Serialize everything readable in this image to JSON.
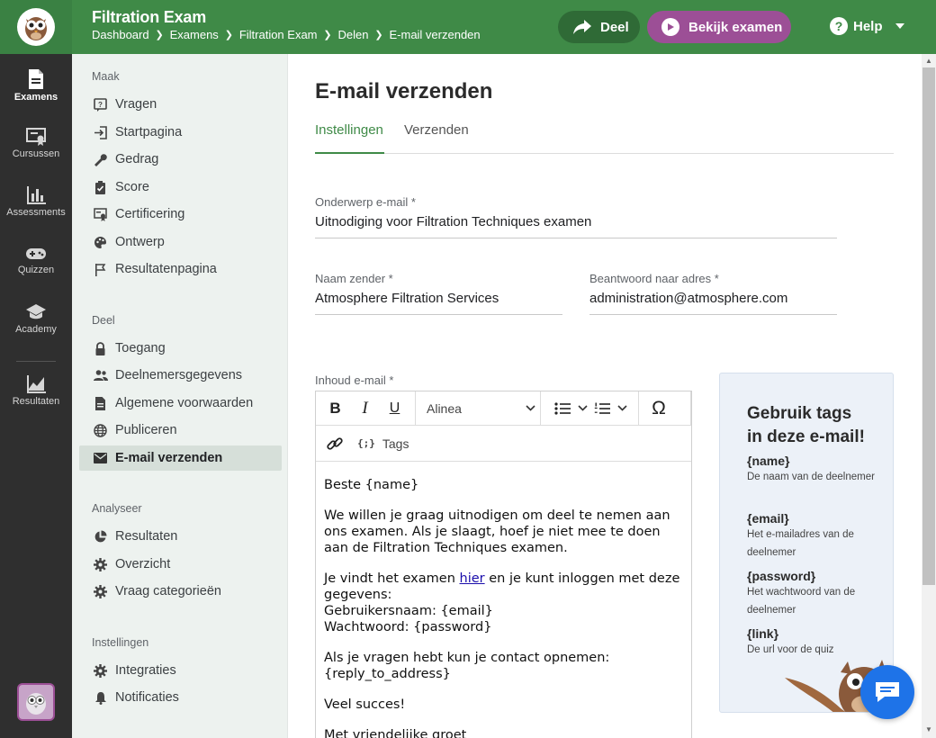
{
  "app": {
    "title": "Filtration Exam",
    "breadcrumb": [
      "Dashboard",
      "Examens",
      "Filtration Exam",
      "Delen",
      "E-mail verzenden"
    ],
    "share_label": "Deel",
    "view_label": "Bekijk examen",
    "help_label": "Help",
    "help_glyph": "?",
    "accent_color": "#3f8a47",
    "view_color": "#9c4f96"
  },
  "rail": {
    "items": [
      {
        "label": "Examens",
        "icon": "document-icon"
      },
      {
        "label": "Cursussen",
        "icon": "certificate-icon"
      },
      {
        "label": "Assessments",
        "icon": "bar-chart-icon"
      },
      {
        "label": "Quizzen",
        "icon": "gamepad-icon"
      },
      {
        "label": "Academy",
        "icon": "graduation-cap-icon"
      },
      {
        "label": "Resultaten",
        "icon": "line-chart-icon"
      }
    ]
  },
  "sidebar": {
    "sections": [
      {
        "title": "Maak",
        "items": [
          "Vragen",
          "Startpagina",
          "Gedrag",
          "Score",
          "Certificering",
          "Ontwerp",
          "Resultatenpagina"
        ]
      },
      {
        "title": "Deel",
        "items": [
          "Toegang",
          "Deelnemersgegevens",
          "Algemene voorwaarden",
          "Publiceren",
          "E-mail verzenden"
        ]
      },
      {
        "title": "Analyseer",
        "items": [
          "Resultaten",
          "Overzicht",
          "Vraag categorieën"
        ]
      },
      {
        "title": "Instellingen",
        "items": [
          "Integraties",
          "Notificaties"
        ]
      }
    ],
    "active_item": "E-mail verzenden"
  },
  "main": {
    "title": "E-mail verzenden",
    "tabs": [
      "Instellingen",
      "Verzenden"
    ],
    "active_tab": "Instellingen",
    "subject": {
      "label": "Onderwerp e-mail *",
      "value": "Uitnodiging voor Filtration Techniques examen"
    },
    "sender": {
      "label": "Naam zender *",
      "value": "Atmosphere Filtration Services"
    },
    "reply": {
      "label": "Beantwoord naar adres *",
      "value": "administration@atmosphere.com"
    },
    "content_label": "Inhoud e-mail *",
    "toolbar": {
      "paragraph": "Alinea",
      "tags": "Tags",
      "special_char": "Ω",
      "tags_glyph": "{;}"
    },
    "body": {
      "greeting": "Beste {name}",
      "p1": "We willen je graag uitnodigen om deel te nemen aan ons examen. Als je slaagt, hoef je niet mee te doen aan de Filtration Techniques examen.",
      "p2_pre": "Je vindt het examen ",
      "p2_link": "hier",
      "p2_post": " en je kunt inloggen met deze gegevens:",
      "username": "Gebruikersnaam: {email}",
      "password": "Wachtwoord: {password}",
      "p3_line1": "Als je vragen hebt kun je contact opnemen:",
      "p3_line2": "{reply_to_address}",
      "p4": "Veel succes!",
      "p5": "Met vriendelijke groet"
    }
  },
  "tagbox": {
    "title_line1": "Gebruik tags",
    "title_line2": "in deze e-mail!",
    "tags": [
      {
        "tag": "{name}",
        "desc": "De naam van de deelnemer"
      },
      {
        "tag": "{email}",
        "desc": "Het e-mailadres van de deelnemer"
      },
      {
        "tag": "{password}",
        "desc": "Het wachtwoord van de deelnemer"
      },
      {
        "tag": "{link}",
        "desc": "De url voor de quiz"
      }
    ]
  }
}
